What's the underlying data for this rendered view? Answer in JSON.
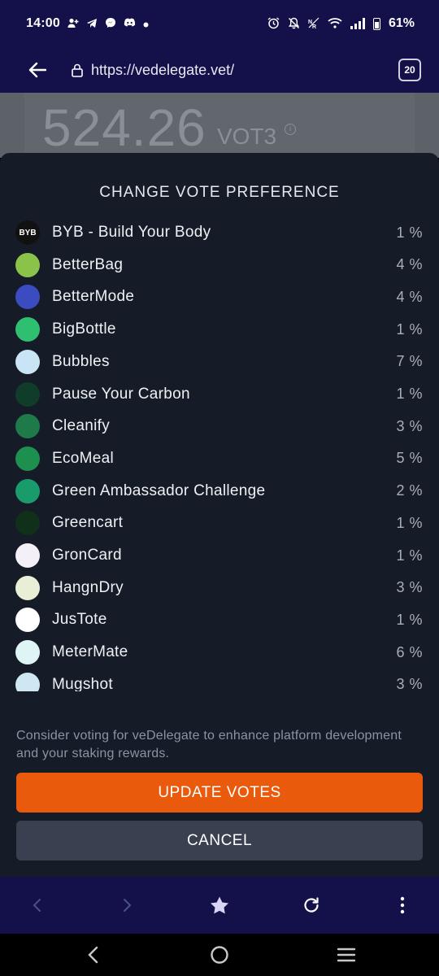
{
  "status_bar": {
    "time": "14:00",
    "battery_percent": "61%",
    "notif_icons": [
      "person-add-icon",
      "telegram-icon",
      "messenger-icon",
      "discord-icon",
      "dot-icon"
    ],
    "system_icons": [
      "alarm-icon",
      "mute-icon",
      "nfc-icon",
      "wifi-icon",
      "signal-icon",
      "battery-icon"
    ]
  },
  "browser": {
    "url": "https://vedelegate.vet/",
    "tab_count": "20"
  },
  "background_page": {
    "amount": "524.26",
    "unit": "VOT3"
  },
  "modal": {
    "title": "CHANGE VOTE PREFERENCE",
    "apps": [
      {
        "name": "BYB - Build Your Body",
        "percent": "1 %",
        "logo_text": "BYB",
        "color": "#111111"
      },
      {
        "name": "BetterBag",
        "percent": "4 %",
        "logo_text": "",
        "color": "#8bc34a"
      },
      {
        "name": "BetterMode",
        "percent": "4 %",
        "logo_text": "",
        "color": "#3b4cc0"
      },
      {
        "name": "BigBottle",
        "percent": "1 %",
        "logo_text": "",
        "color": "#2fbf71"
      },
      {
        "name": "Bubbles",
        "percent": "7 %",
        "logo_text": "",
        "color": "#c9e4f5"
      },
      {
        "name": "Pause Your Carbon",
        "percent": "1 %",
        "logo_text": "",
        "color": "#0f3d2a"
      },
      {
        "name": "Cleanify",
        "percent": "3 %",
        "logo_text": "",
        "color": "#1f7a4a"
      },
      {
        "name": "EcoMeal",
        "percent": "5 %",
        "logo_text": "",
        "color": "#1d8f4e"
      },
      {
        "name": "Green Ambassador Challenge",
        "percent": "2 %",
        "logo_text": "",
        "color": "#1a9b6c"
      },
      {
        "name": "Greencart",
        "percent": "1 %",
        "logo_text": "",
        "color": "#10301a"
      },
      {
        "name": "GronCard",
        "percent": "1 %",
        "logo_text": "",
        "color": "#f4f0f8"
      },
      {
        "name": "HangnDry",
        "percent": "3 %",
        "logo_text": "",
        "color": "#e9efd6"
      },
      {
        "name": "JusTote",
        "percent": "1 %",
        "logo_text": "",
        "color": "#ffffff"
      },
      {
        "name": "MeterMate",
        "percent": "6 %",
        "logo_text": "",
        "color": "#dff4f4"
      },
      {
        "name": "Mugshot",
        "percent": "3 %",
        "logo_text": "",
        "color": "#cfe7f2"
      }
    ],
    "consider_text": "Consider voting for veDelegate to enhance platform development and your staking rewards.",
    "update_label": "UPDATE VOTES",
    "cancel_label": "CANCEL"
  },
  "colors": {
    "chrome_bg": "#14104a",
    "modal_bg": "#161b28",
    "update_button": "#ea5a0d",
    "cancel_button": "#394150"
  },
  "toolbar_icons": [
    "back-icon",
    "forward-icon",
    "bookmark-star-icon",
    "reload-icon",
    "more-icon"
  ],
  "nav_icons": [
    "nav-back-icon",
    "nav-home-icon",
    "nav-recents-icon"
  ]
}
